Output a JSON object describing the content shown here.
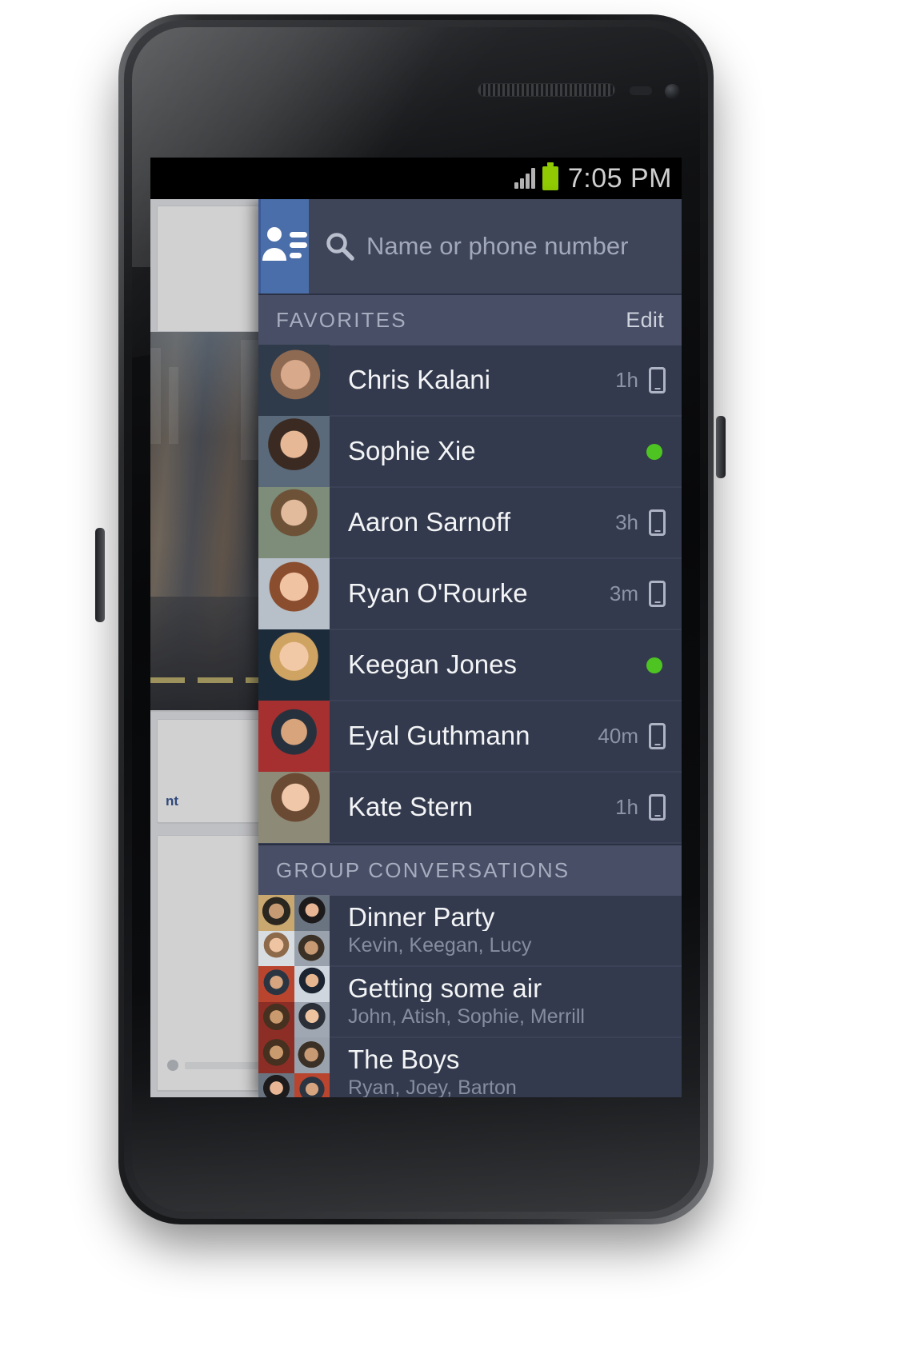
{
  "status_bar": {
    "time": "7:05 PM",
    "signal_icon": "signal-bars-icon",
    "battery_icon": "battery-icon"
  },
  "top_bar": {
    "contacts_button_icon": "contacts-list-icon",
    "search": {
      "icon": "search-icon",
      "placeholder": "Name or phone number",
      "value": ""
    },
    "add_button_label": "+"
  },
  "sections": [
    {
      "title": "FAVORITES",
      "action_label": "Edit",
      "rows": [
        {
          "name": "Chris Kalani",
          "timestamp": "1h",
          "indicator": "mobile",
          "avatar": "f1"
        },
        {
          "name": "Sophie Xie",
          "timestamp": "",
          "indicator": "online",
          "avatar": "f2"
        },
        {
          "name": "Aaron Sarnoff",
          "timestamp": "3h",
          "indicator": "mobile",
          "avatar": "f3"
        },
        {
          "name": "Ryan O'Rourke",
          "timestamp": "3m",
          "indicator": "mobile",
          "avatar": "f4"
        },
        {
          "name": "Keegan Jones",
          "timestamp": "",
          "indicator": "online",
          "avatar": "f5"
        },
        {
          "name": "Eyal Guthmann",
          "timestamp": "40m",
          "indicator": "mobile",
          "avatar": "f6"
        },
        {
          "name": "Kate Stern",
          "timestamp": "1h",
          "indicator": "mobile",
          "avatar": "f7"
        }
      ]
    },
    {
      "title": "GROUP CONVERSATIONS",
      "action_label": "",
      "rows": [
        {
          "name": "Dinner Party",
          "members": "Kevin, Keegan, Lucy",
          "avatars": [
            "g1",
            "g2",
            "g3",
            "g4"
          ]
        },
        {
          "name": "Getting some air",
          "members": "John, Atish, Sophie, Merrill",
          "avatars": [
            "g5",
            "g6",
            "g7",
            "g8"
          ]
        },
        {
          "name": "The Boys",
          "members": "Ryan, Joey, Barton",
          "avatars": [
            "g7",
            "g4",
            "g2",
            "g5"
          ]
        },
        {
          "name": "",
          "members": "",
          "avatars": [
            "g6",
            "g1",
            "g3",
            "g8"
          ]
        }
      ]
    }
  ],
  "background_app": {
    "card_menu_icon": "overflow-menu-icon",
    "truncated_label": "nt"
  },
  "colors": {
    "brand_blue": "#4a6ea9",
    "panel_bg": "#333a4d",
    "section_bg": "#474e66",
    "online_green": "#4ec422",
    "battery_green": "#8fca02"
  }
}
